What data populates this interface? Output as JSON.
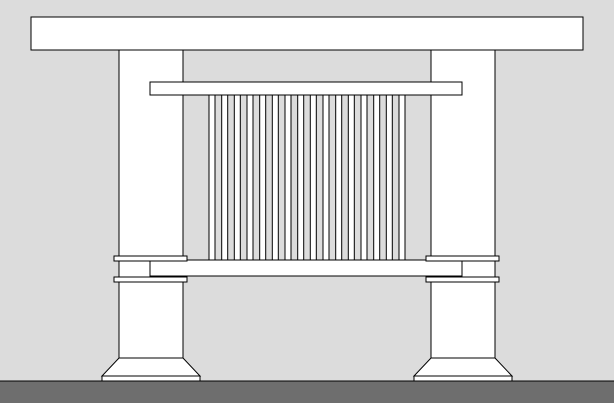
{
  "colors": {
    "background": "#dcdcdc",
    "ground": "#6e6e6e",
    "structure_fill": "#ffffff",
    "outline": "#000000"
  },
  "drawing": {
    "subject": "pergola-front-elevation",
    "posts": 2,
    "baluster_count": 16
  }
}
